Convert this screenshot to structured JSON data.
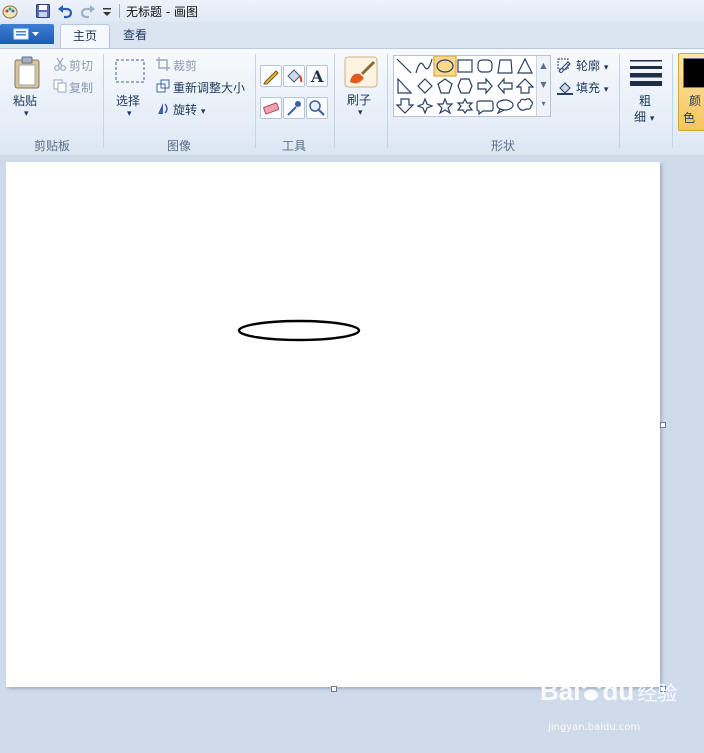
{
  "window": {
    "title": "无标题 - 画图"
  },
  "tabs": [
    {
      "label": "主页"
    },
    {
      "label": "查看"
    }
  ],
  "clipboard": {
    "paste_label": "粘贴",
    "cut_label": "剪切",
    "copy_label": "复制",
    "group_label": "剪贴板"
  },
  "image": {
    "select_label": "选择",
    "crop_label": "裁剪",
    "resize_label": "重新调整大小",
    "rotate_label": "旋转",
    "group_label": "图像"
  },
  "tools": {
    "group_label": "工具"
  },
  "brushes": {
    "label": "刷子"
  },
  "shapes": {
    "outline_label": "轮廓",
    "fill_label": "填充",
    "group_label": "形状"
  },
  "size": {
    "label_line1": "粗",
    "label_line2": "细"
  },
  "colors": {
    "label_line1": "颜",
    "label_line2": "色",
    "color1": "#000000"
  },
  "watermark": {
    "brand": "Bai",
    "brand2": "du",
    "suffix": "经验",
    "url": "jingyan.baidu.com"
  }
}
